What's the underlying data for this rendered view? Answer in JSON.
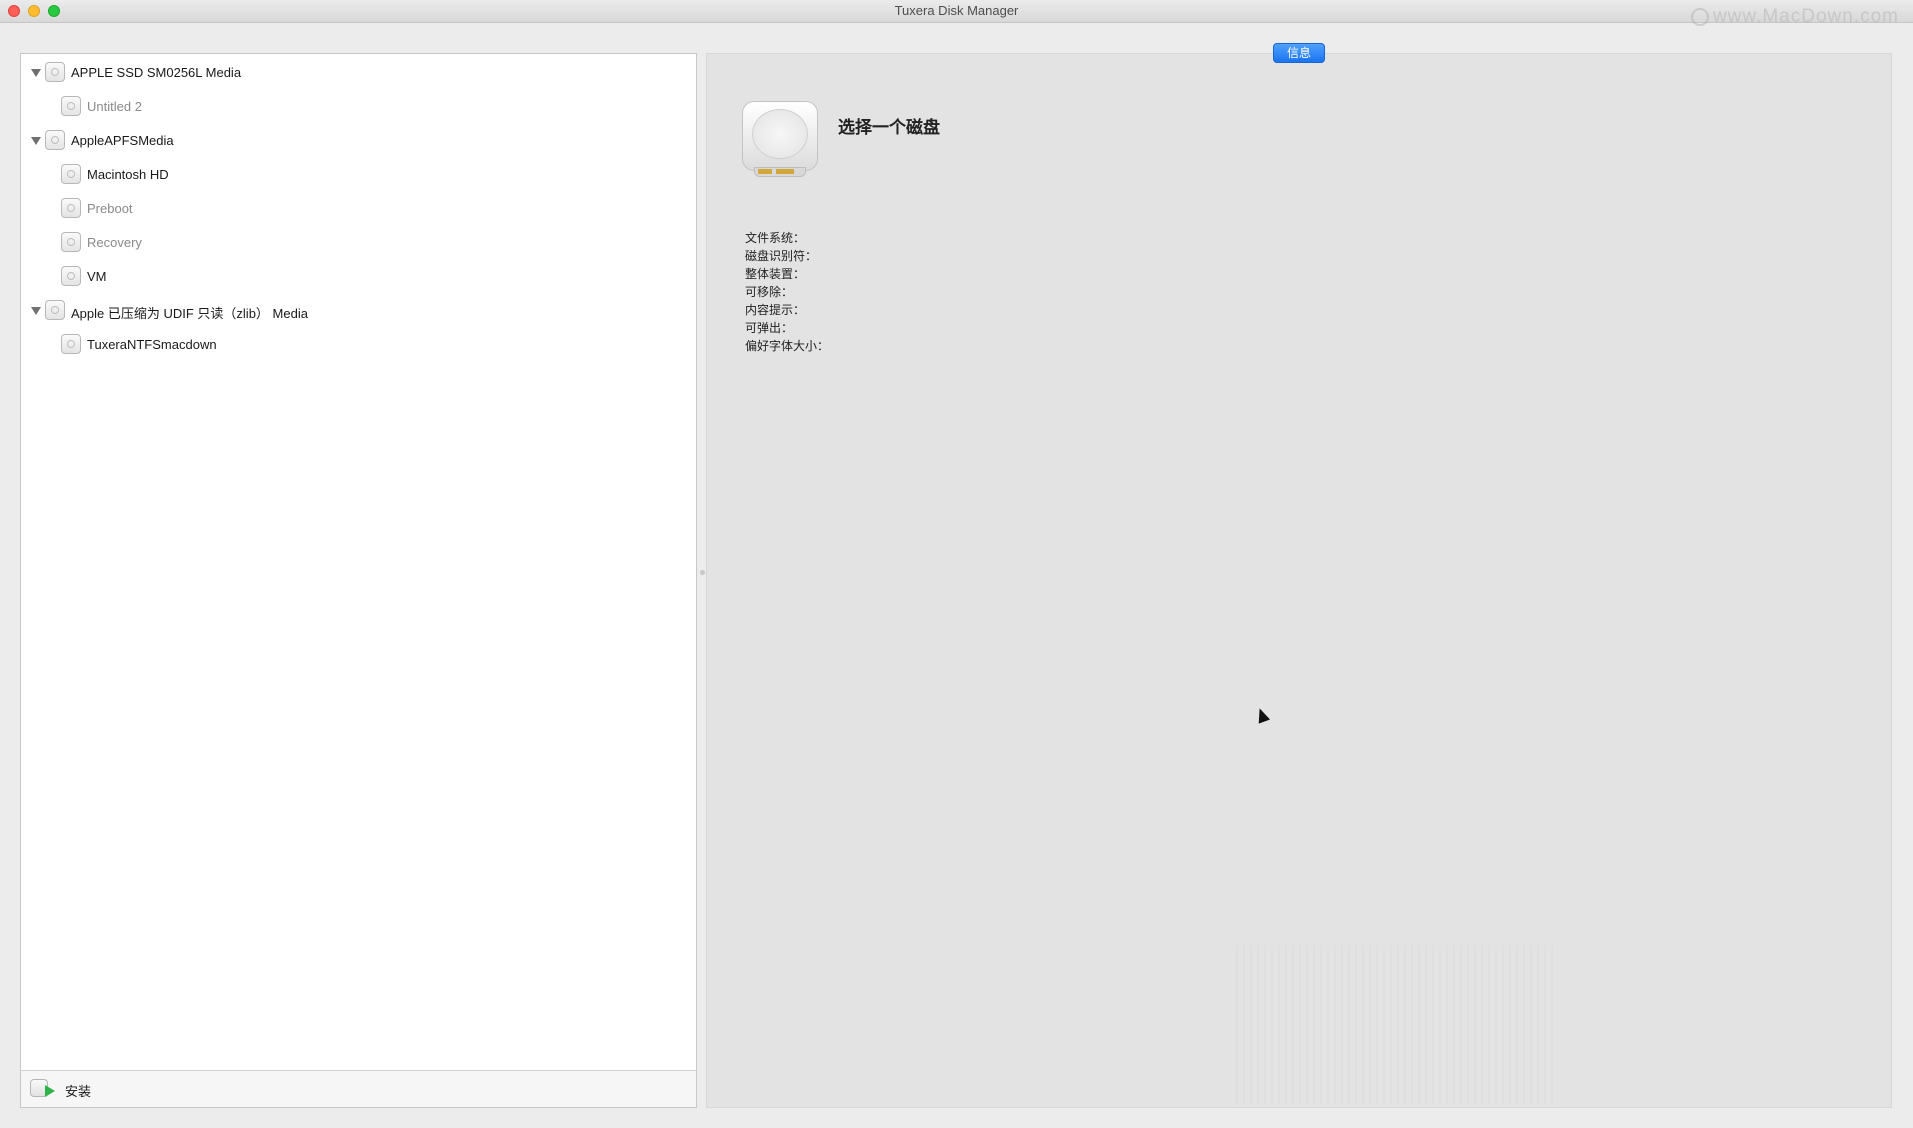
{
  "window": {
    "title": "Tuxera Disk Manager",
    "watermark": "www.MacDown.com"
  },
  "sidebar": {
    "items": [
      {
        "label": "APPLE SSD SM0256L Media",
        "level": 0,
        "expanded": true,
        "enabled": true
      },
      {
        "label": "Untitled 2",
        "level": 1,
        "enabled": false
      },
      {
        "label": "AppleAPFSMedia",
        "level": 0,
        "expanded": true,
        "enabled": true
      },
      {
        "label": "Macintosh HD",
        "level": 1,
        "enabled": true
      },
      {
        "label": "Preboot",
        "level": 1,
        "enabled": false
      },
      {
        "label": "Recovery",
        "level": 1,
        "enabled": false
      },
      {
        "label": "VM",
        "level": 1,
        "enabled": true
      },
      {
        "label": "Apple 已压缩为 UDIF 只读（zlib） Media",
        "level": 0,
        "expanded": true,
        "enabled": true
      },
      {
        "label": "TuxeraNTFSmacdown",
        "level": 1,
        "enabled": true
      }
    ],
    "footer": {
      "mount_label": "安装"
    }
  },
  "info": {
    "tab_label": "信息",
    "heading": "选择一个磁盘",
    "properties": [
      "文件系统：",
      "磁盘识别符：",
      "整体装置：",
      "可移除：",
      "内容提示：",
      "可弹出：",
      "偏好字体大小："
    ]
  },
  "colors": {
    "accent": "#1b74f0",
    "close": "#fe5f57",
    "minimize": "#febc2e",
    "zoom": "#28c840",
    "mount_arrow": "#2fb24b"
  }
}
